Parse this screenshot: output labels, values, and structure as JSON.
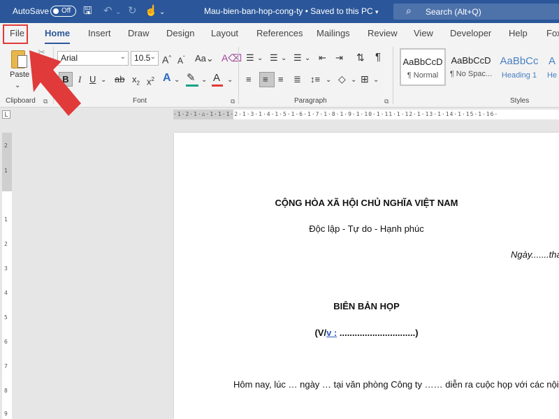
{
  "titlebar": {
    "autosave_label": "AutoSave",
    "toggle_state": "Off",
    "document_title": "Mau-bien-ban-hop-cong-ty • Saved to this PC",
    "search_placeholder": "Search (Alt+Q)"
  },
  "tabs": [
    {
      "label": "File"
    },
    {
      "label": "Home"
    },
    {
      "label": "Insert"
    },
    {
      "label": "Draw"
    },
    {
      "label": "Design"
    },
    {
      "label": "Layout"
    },
    {
      "label": "References"
    },
    {
      "label": "Mailings"
    },
    {
      "label": "Review"
    },
    {
      "label": "View"
    },
    {
      "label": "Developer"
    },
    {
      "label": "Help"
    },
    {
      "label": "Fox"
    }
  ],
  "ribbon": {
    "clipboard": {
      "paste_label": "Paste",
      "group_label": "Clipboard"
    },
    "font": {
      "font_name": "Arial",
      "font_size": "10.5",
      "group_label": "Font"
    },
    "paragraph": {
      "group_label": "Paragraph"
    },
    "styles": {
      "group_label": "Styles",
      "items": [
        {
          "sample": "AaBbCcD",
          "name": "¶ Normal"
        },
        {
          "sample": "AaBbCcD",
          "name": "¶ No Spac..."
        },
        {
          "sample": "AaBbCc",
          "name": "Heading 1"
        },
        {
          "sample": "A",
          "name": "He"
        }
      ]
    }
  },
  "document": {
    "line1": "CỘNG HÒA XÃ HỘI CHỦ NGHĨA VIỆT NAM",
    "line2": "Độc lập - Tự do - Hạnh phúc",
    "line3": "Ngày.......thá",
    "heading": "BIÊN BẢN HỌP",
    "vv_open": "(V/",
    "vv_link": "v :",
    "vv_dots": " ..............................)",
    "body": "Hôm nay, lúc … ngày … tại văn phòng Công ty ……  diễn ra cuộc họp với các nội du"
  },
  "colors": {
    "word_blue": "#2b579a",
    "annotation_red": "#e03a3a"
  }
}
